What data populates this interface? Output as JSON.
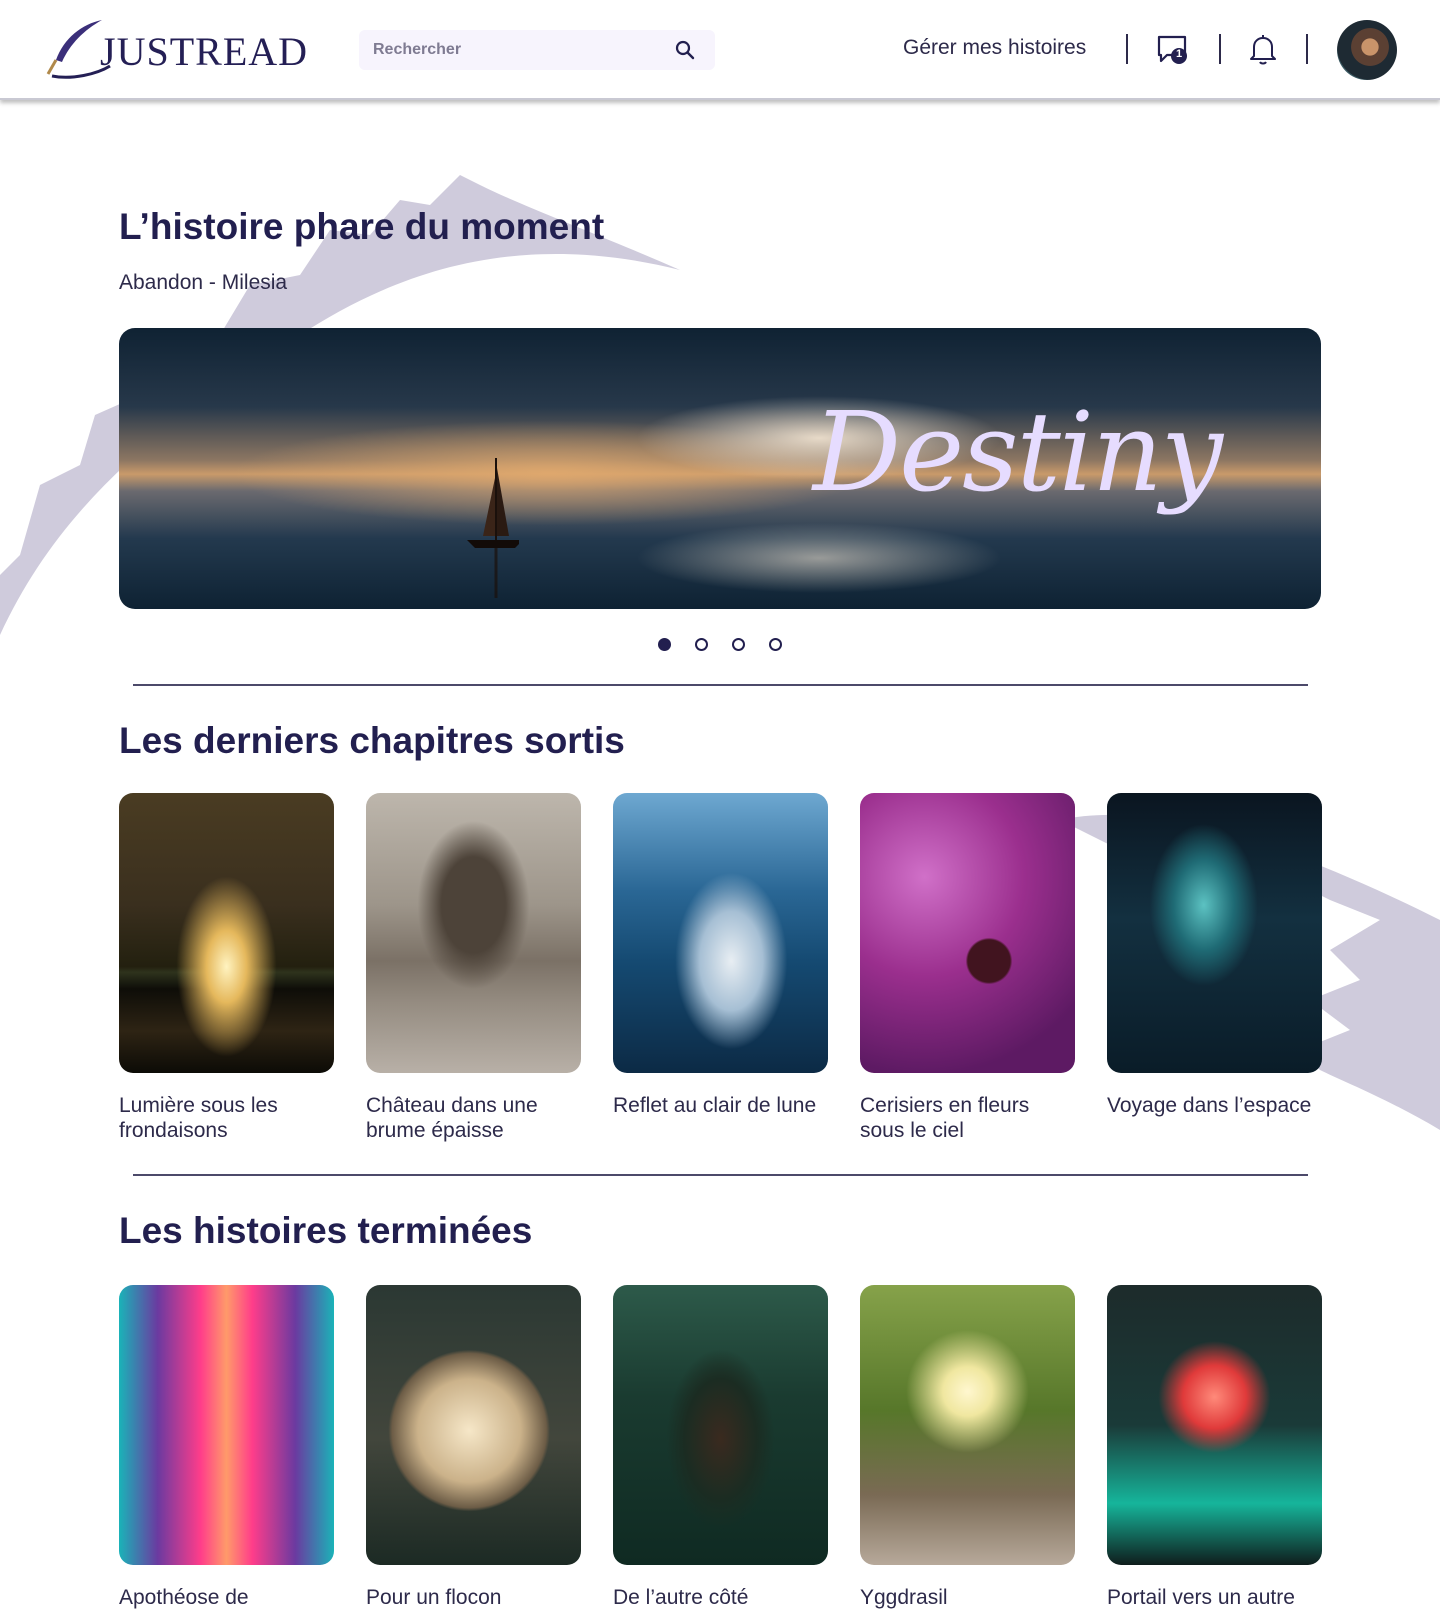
{
  "header": {
    "logo_text": "JUSTREAD",
    "search_placeholder": "Rechercher",
    "nav_link": "Gérer mes histoires",
    "messages_badge": "1"
  },
  "featured": {
    "title": "L’histoire phare du moment",
    "subtitle": "Abandon - Milesia",
    "banner_text": "Destiny",
    "carousel": {
      "count": 4,
      "active_index": 0
    }
  },
  "latest": {
    "title": "Les derniers chapitres sortis",
    "cards": [
      {
        "title": "Lumière sous les frondaisons"
      },
      {
        "title": "Château dans une brume épaisse"
      },
      {
        "title": "Reflet au clair de lune"
      },
      {
        "title": "Cerisiers en fleurs sous le ciel"
      },
      {
        "title": "Voyage dans l’espace"
      }
    ]
  },
  "finished": {
    "title": "Les histoires terminées",
    "cards": [
      {
        "title": "Apothéose de"
      },
      {
        "title": "Pour un flocon"
      },
      {
        "title": "De l’autre côté"
      },
      {
        "title": "Yggdrasil"
      },
      {
        "title": "Portail vers un autre"
      }
    ]
  },
  "colors": {
    "primary": "#221f4f",
    "accent_light": "#f7f4fd",
    "feather": "#cfcbdc"
  }
}
